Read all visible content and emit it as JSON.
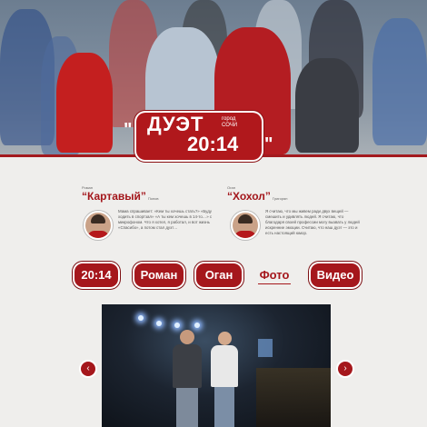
{
  "logo": {
    "line1": "ДУЭТ",
    "line2": "20:14",
    "city": "город СОЧИ",
    "quote_open": "\"",
    "quote_close": "\""
  },
  "profiles": [
    {
      "role": "Роман",
      "name": "“Картавый”",
      "surname": "Попов",
      "text": "Мама спрашивает: «Кем ты хочешь стать?» «Буду ходить в спортзал» «А ты кем хочешь в 14-то…» с микрофоном. Что я хотел, я работал, и вот жизнь «Спасибо», а потом стал дуэт…"
    },
    {
      "role": "Оган",
      "name": "“Хохол”",
      "surname": "Григорян",
      "text": "Я считаю, что мы живем ради двух вещей — смешить и удивлять людей. Я считаю, что благодаря своей профессии могу вызвать у людей искренние эмоции. Считаю, что наш дуэт — это и есть настоящий юмор."
    }
  ],
  "nav": [
    "20:14",
    "Роман",
    "Оган",
    "Фото",
    "Видео"
  ],
  "nav_active": "Фото",
  "gallery": {
    "prev": "‹",
    "next": "›"
  },
  "colors": {
    "accent": "#a5171c",
    "background": "#efeeec"
  }
}
